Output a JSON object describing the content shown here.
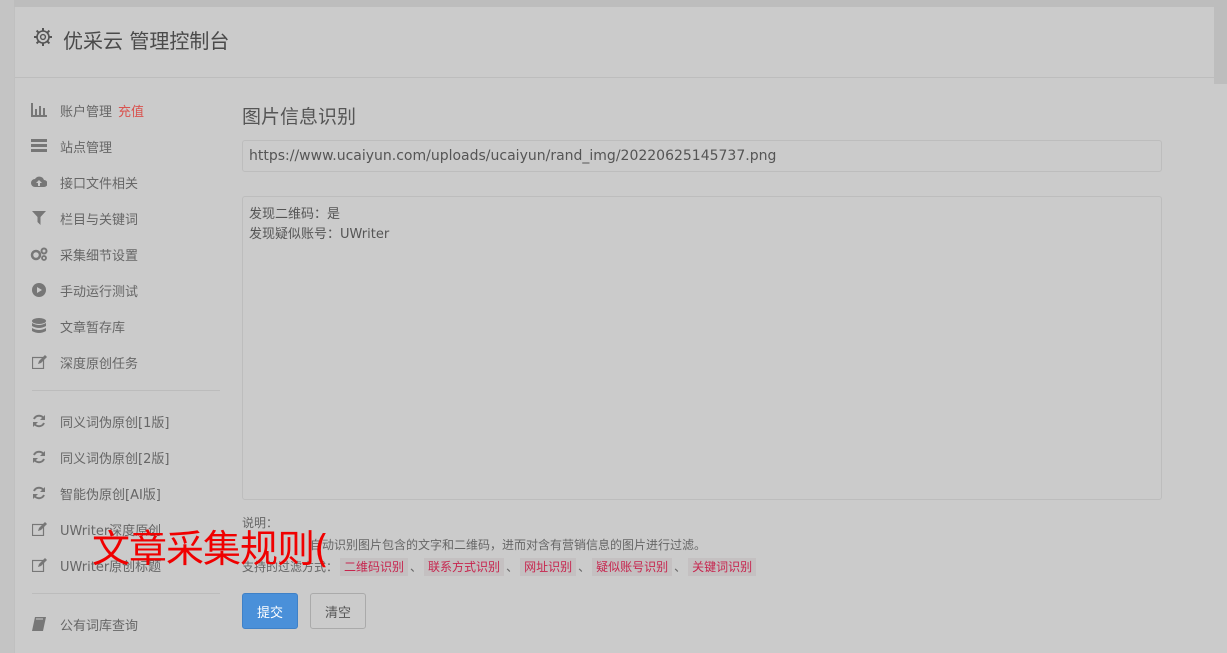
{
  "header": {
    "title": "优采云 管理控制台",
    "icon": "gear-icon"
  },
  "sidebar": {
    "group1": [
      {
        "label": "账户管理",
        "highlight": "充值",
        "icon": "bar-chart-icon"
      },
      {
        "label": "站点管理",
        "icon": "server-icon"
      },
      {
        "label": "接口文件相关",
        "icon": "cloud-upload-icon"
      },
      {
        "label": "栏目与关键词",
        "icon": "filter-icon"
      },
      {
        "label": "采集细节设置",
        "icon": "cogs-icon"
      },
      {
        "label": "手动运行测试",
        "icon": "play-circle-icon"
      },
      {
        "label": "文章暂存库",
        "icon": "database-icon"
      },
      {
        "label": "深度原创任务",
        "icon": "edit-icon"
      }
    ],
    "group2": [
      {
        "label": "同义词伪原创[1版]",
        "icon": "refresh-icon"
      },
      {
        "label": "同义词伪原创[2版]",
        "icon": "refresh-icon"
      },
      {
        "label": "智能伪原创[AI版]",
        "icon": "refresh-icon"
      },
      {
        "label": "UWriter深度原创",
        "icon": "edit-icon"
      },
      {
        "label": "UWriter原创标题",
        "icon": "edit-icon"
      }
    ],
    "group3": [
      {
        "label": "公有词库查询",
        "icon": "book-icon"
      }
    ]
  },
  "main": {
    "title": "图片信息识别",
    "url_value": "https://www.ucaiyun.com/uploads/ucaiyun/rand_img/20220625145737.png",
    "result_lines": [
      "发现二维码：是",
      "发现疑似账号：UWriter"
    ],
    "notes_label": "说明：",
    "notes_desc": "自动识别图片包含的文字和二维码，进而对含有营销信息的图片进行过滤。",
    "filters_label": "支持的过滤方式：",
    "filters": [
      "二维码识别",
      "联系方式识别",
      "网址识别",
      "疑似账号识别",
      "关键词识别"
    ],
    "submit_label": "提交",
    "clear_label": "清空"
  },
  "overlay": {
    "text": "文章采集规则("
  },
  "colors": {
    "accent": "#4a90d9",
    "highlight": "#d9534f",
    "overlay": "#f00000",
    "tag_text": "#c7254e"
  }
}
